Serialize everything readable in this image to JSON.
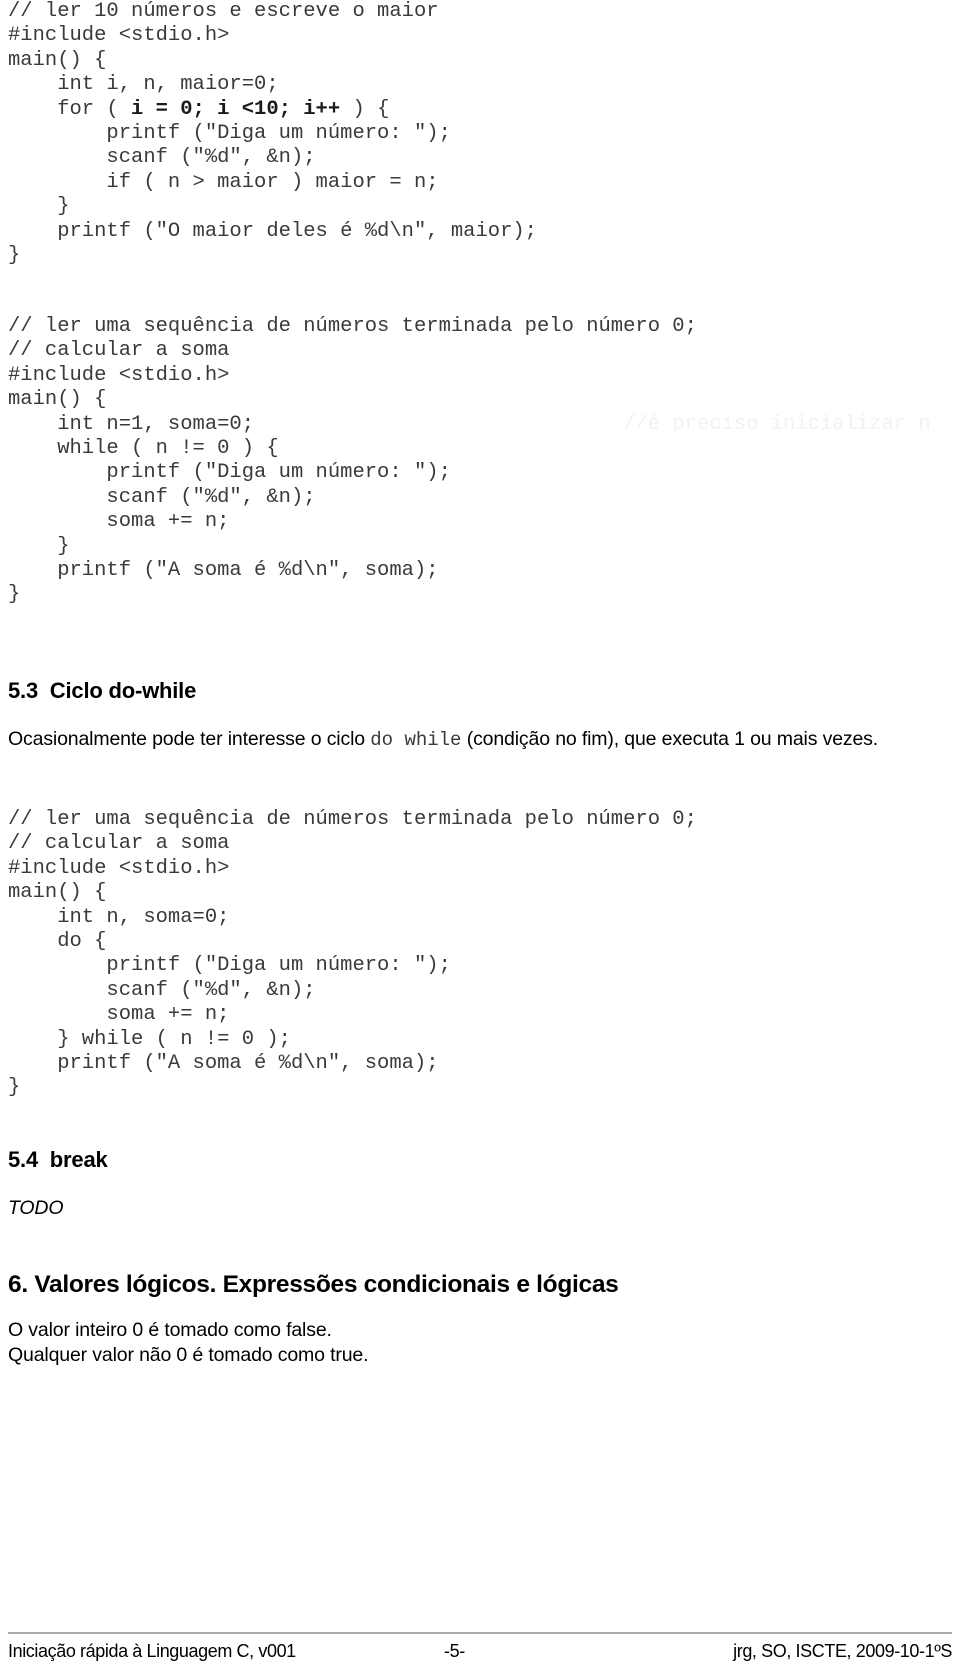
{
  "document": {
    "code_block_1": {
      "name": "maior-de-10-numeros",
      "lines": [
        {
          "text": "// ler 10 números e escreve o maior"
        },
        {
          "text": "#include <stdio.h>"
        },
        {
          "text": "main() {"
        },
        {
          "text": "    int i, n, maior=0;"
        },
        {
          "pre": "    for ( ",
          "bold": "i = 0; i <10; i++",
          "post": " ) {"
        },
        {
          "text": "        printf (\"Diga um número: \");"
        },
        {
          "text": "        scanf (\"%d\", &n);"
        },
        {
          "text": "        if ( n > maior ) maior = n;"
        },
        {
          "text": "    }"
        },
        {
          "text": "    printf (\"O maior deles é %d\\n\", maior);"
        },
        {
          "text": "}"
        }
      ]
    },
    "code_block_2": {
      "name": "soma-while",
      "lines": [
        {
          "text": "// ler uma sequência de números terminada pelo número 0;"
        },
        {
          "text": "// calcular a soma"
        },
        {
          "text": "#include <stdio.h>"
        },
        {
          "text": "main() {"
        },
        {
          "text": "    int n=1, soma=0;",
          "ghost_pad": "                              ",
          "ghost": "//é preciso inicializar n"
        },
        {
          "text": "    while ( n != 0 ) {"
        },
        {
          "text": "        printf (\"Diga um número: \");"
        },
        {
          "text": "        scanf (\"%d\", &n);"
        },
        {
          "text": "        soma += n;"
        },
        {
          "text": "    }"
        },
        {
          "text": "    printf (\"A soma é %d\\n\", soma);"
        },
        {
          "text": "}"
        }
      ]
    },
    "code_block_3": {
      "name": "soma-do-while",
      "lines": [
        {
          "text": "// ler uma sequência de números terminada pelo número 0;"
        },
        {
          "text": "// calcular a soma"
        },
        {
          "text": "#include <stdio.h>"
        },
        {
          "text": "main() {"
        },
        {
          "text": "    int n, soma=0;"
        },
        {
          "text": "    do {"
        },
        {
          "text": "        printf (\"Diga um número: \");"
        },
        {
          "text": "        scanf (\"%d\", &n);"
        },
        {
          "text": "        soma += n;"
        },
        {
          "text": "    } while ( n != 0 );"
        },
        {
          "text": "    printf (\"A soma é %d\\n\", soma);"
        },
        {
          "text": "}"
        }
      ]
    },
    "heading_53": "5.3  Ciclo do-while",
    "heading_54": "5.4  break",
    "heading_6": "6. Valores lógicos. Expressões condicionais e lógicas",
    "paragraph_do_while": {
      "part1": "Ocasionalmente pode ter interesse o ciclo ",
      "code": "do while",
      "part2": " (condição no fim), que executa 1 ou mais vezes."
    },
    "paragraph_todo": "TODO",
    "paragraph_bool": {
      "line1": "O valor inteiro 0 é tomado como false.",
      "line2": "Qualquer valor não 0 é tomado como true."
    },
    "footer": {
      "left": "Iniciação rápida à Linguagem C, v001",
      "center": "-5-",
      "right": "jrg, SO, ISCTE, 2009-10-1ºS"
    }
  }
}
